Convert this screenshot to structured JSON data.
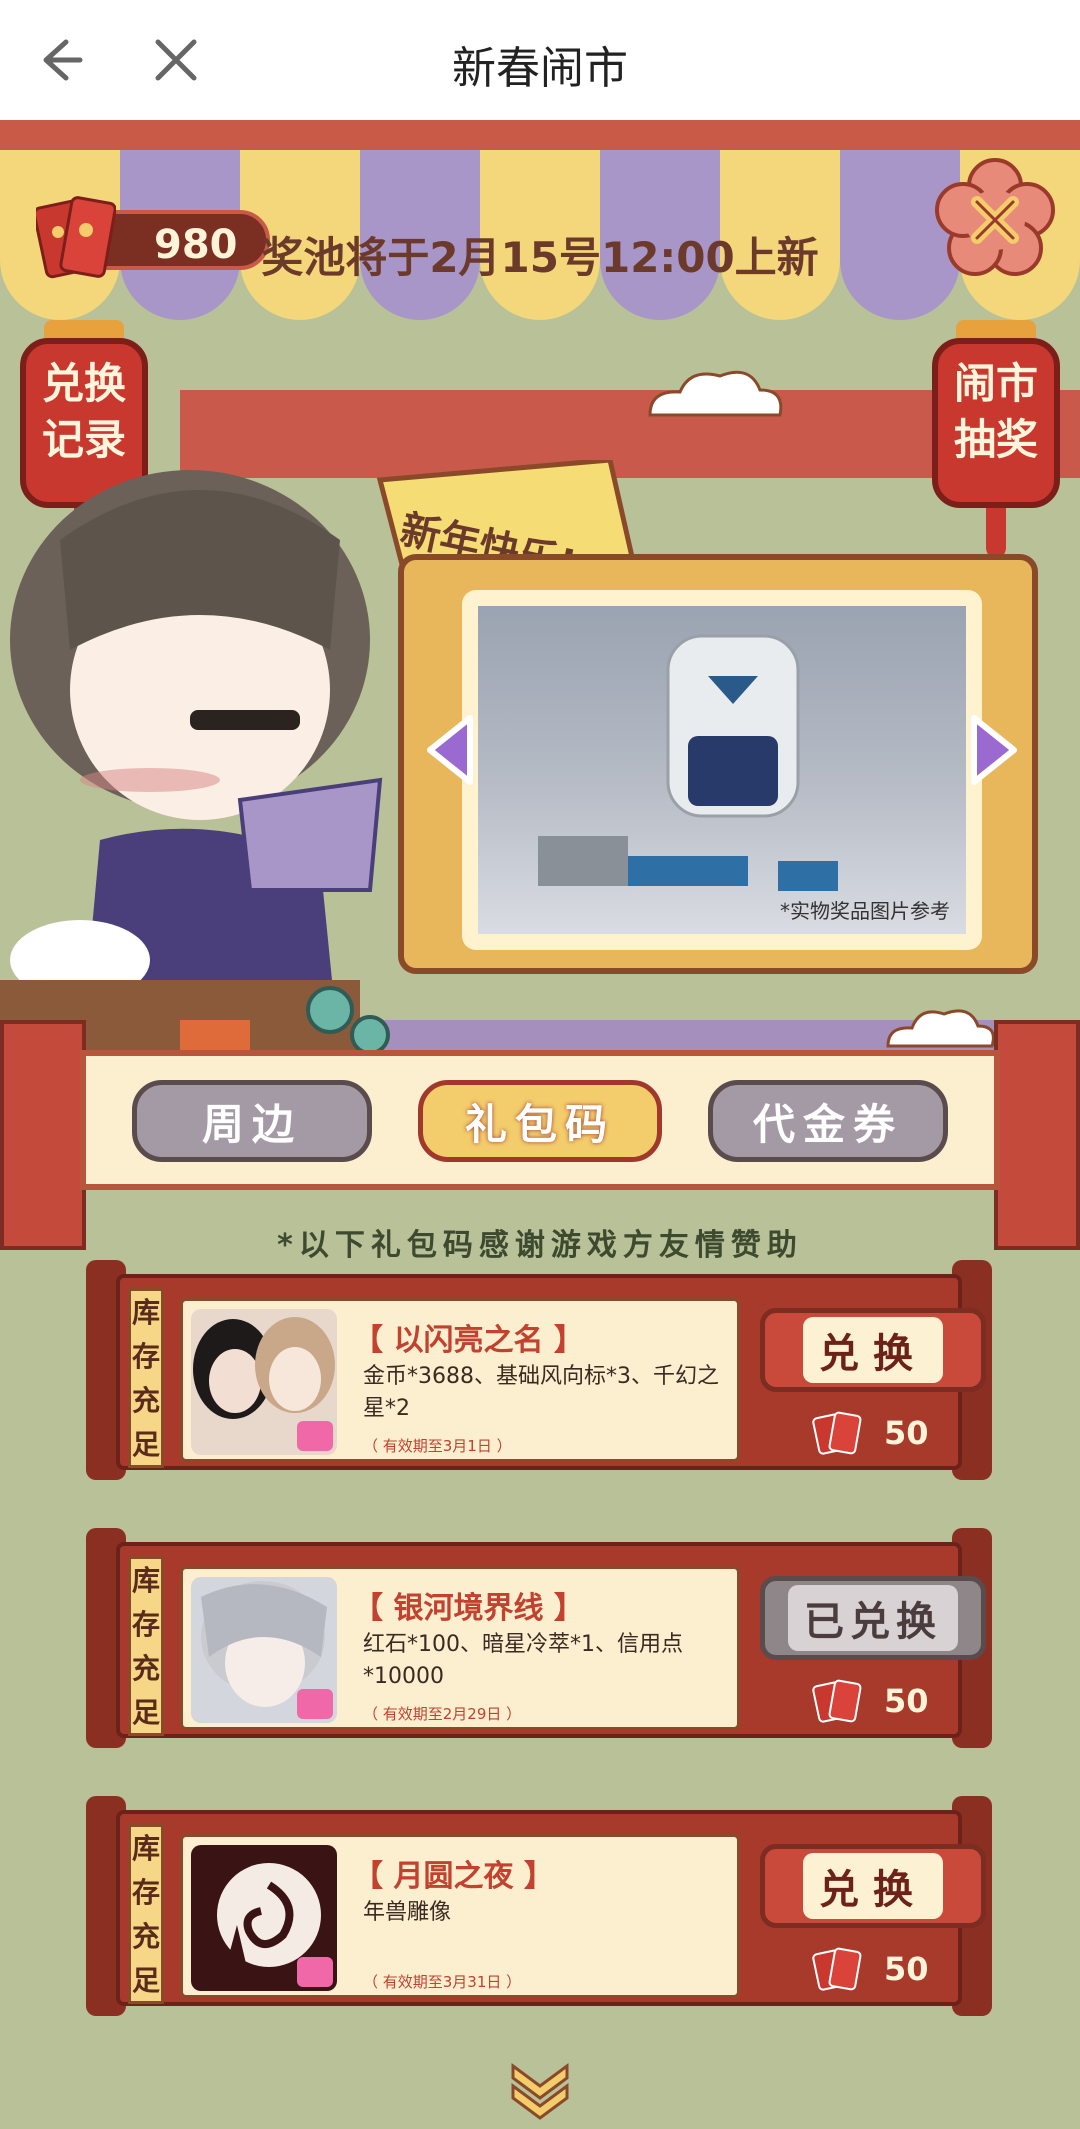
{
  "topbar": {
    "title": "新春闹市"
  },
  "header": {
    "coins": "980",
    "announcement": "奖池将于2月15号12:00上新"
  },
  "lanterns": {
    "left": "兑换记录",
    "right": "闹市抽奖"
  },
  "speech_bubble": "新年快乐!",
  "prize": {
    "caption": "*实物奖品图片参考"
  },
  "tabs": [
    {
      "label": "周边",
      "active": false
    },
    {
      "label": "礼包码",
      "active": true
    },
    {
      "label": "代金券",
      "active": false
    }
  ],
  "note": "*以下礼包码感谢游戏方友情赞助",
  "cards": [
    {
      "stock": "库存充足",
      "name": "【 以闪亮之名 】",
      "desc": "金币*3688、基础风向标*3、千幻之星*2",
      "expiry": "（ 有效期至3月1日 ）",
      "button": "兑换",
      "cost": "50"
    },
    {
      "stock": "库存充足",
      "name": "【 银河境界线 】",
      "desc": "红石*100、暗星冷萃*1、信用点*10000",
      "expiry": "（ 有效期至2月29日 ）",
      "button": "已兑换",
      "cost": "50"
    },
    {
      "stock": "库存充足",
      "name": "【 月圆之夜 】",
      "desc": "年兽雕像",
      "expiry": "（ 有效期至3月31日 ）",
      "button": "兑换",
      "cost": "50"
    }
  ]
}
